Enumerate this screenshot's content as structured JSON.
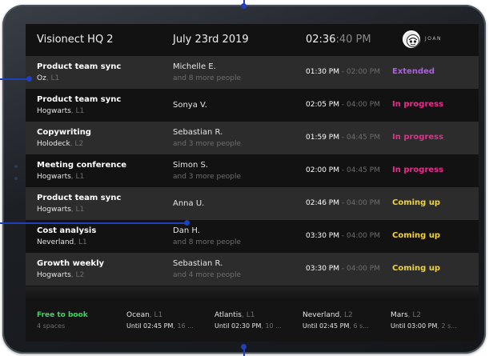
{
  "header": {
    "location": "Visionect HQ 2",
    "date": "July 23rd 2019",
    "time_main": "02:36",
    "time_secondary": ":40 PM",
    "logo_text": "JOAN"
  },
  "colors": {
    "extended": "#b05ce6",
    "in_progress": "#e52e8c",
    "coming_up": "#f0d23a",
    "free": "#3ad860",
    "callout": "#1f3fbf"
  },
  "meetings": [
    {
      "title": "Product team sync",
      "room": "Oz",
      "level": ", L1",
      "person": "Michelle E.",
      "more": "and 8 more people",
      "start": "01:30 PM",
      "end": " - 02:00 PM",
      "status": "Extended",
      "status_color": "#b05ce6"
    },
    {
      "title": "Product team sync",
      "room": "Hogwarts",
      "level": ", L1",
      "person": "Sonya V.",
      "more": "",
      "start": "02:05 PM",
      "end": " - 04:00 PM",
      "status": "In progress",
      "status_color": "#e52e8c"
    },
    {
      "title": "Copywriting",
      "room": "Holodeck",
      "level": ", L2",
      "person": "Sebastian R.",
      "more": "and 3 more people",
      "start": "01:59 PM",
      "end": " - 04:45 PM",
      "status": "In progress",
      "status_color": "#e52e8c"
    },
    {
      "title": "Meeting conference",
      "room": "Hogwarts",
      "level": ", L1",
      "person": "Simon S.",
      "more": "and 3 more people",
      "start": "02:00 PM",
      "end": " - 04:45 PM",
      "status": "In progress",
      "status_color": "#e52e8c"
    },
    {
      "title": "Product team sync",
      "room": "Hogwarts",
      "level": ", L1",
      "person": "Anna U.",
      "more": "",
      "start": "02:46 PM",
      "end": " - 04:00 PM",
      "status": "Coming up",
      "status_color": "#f0d23a"
    },
    {
      "title": "Cost analysis",
      "room": "Neverland",
      "level": ", L1",
      "person": "Dan H.",
      "more": "and 8 more people",
      "start": "03:30 PM",
      "end": " - 04:00 PM",
      "status": "Coming up",
      "status_color": "#f0d23a"
    },
    {
      "title": "Growth weekly",
      "room": "Hogwarts",
      "level": ", L2",
      "person": "Sebastian R.",
      "more": "and 4 more people",
      "start": "03:30 PM",
      "end": " - 04:00 PM",
      "status": "Coming up",
      "status_color": "#f0d23a"
    }
  ],
  "footer": {
    "free_label": "Free to book",
    "free_count": "4 spaces",
    "rooms": [
      {
        "name": "Ocean",
        "level": ", L1",
        "until": "Until 02:45 PM",
        "duration": ", 16 ..."
      },
      {
        "name": "Atlantis",
        "level": ", L1",
        "until": "Until 02:30 PM",
        "duration": ", 10 ..."
      },
      {
        "name": "Neverland",
        "level": ", L2",
        "until": "Until 02:45 PM",
        "duration": ", 6 s..."
      },
      {
        "name": "Mars",
        "level": ", L2",
        "until": "Until 03:00 PM",
        "duration": ", 2 s..."
      }
    ]
  }
}
